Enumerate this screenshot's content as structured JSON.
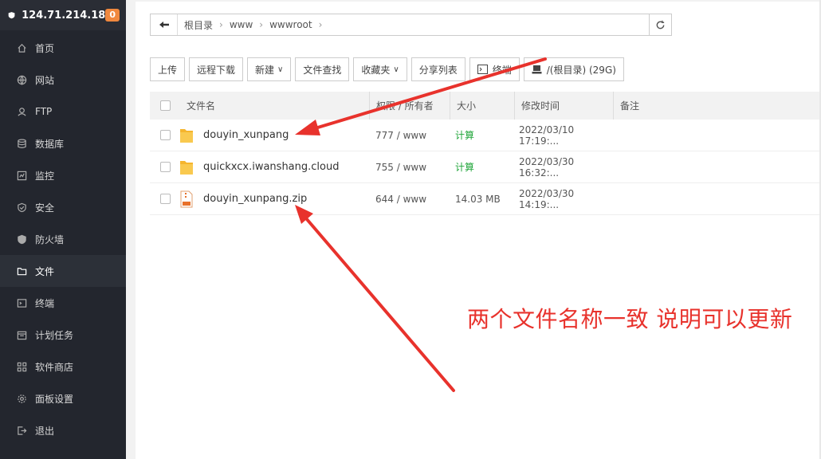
{
  "sidebar": {
    "ip": "124.71.214.18",
    "badge": "0",
    "items": [
      {
        "label": "首页",
        "icon": "home-icon"
      },
      {
        "label": "网站",
        "icon": "globe-icon"
      },
      {
        "label": "FTP",
        "icon": "ftp-icon"
      },
      {
        "label": "数据库",
        "icon": "database-icon"
      },
      {
        "label": "监控",
        "icon": "monitor-icon"
      },
      {
        "label": "安全",
        "icon": "shield-icon"
      },
      {
        "label": "防火墙",
        "icon": "firewall-icon"
      },
      {
        "label": "文件",
        "icon": "folder-icon"
      },
      {
        "label": "终端",
        "icon": "terminal-icon"
      },
      {
        "label": "计划任务",
        "icon": "calendar-icon"
      },
      {
        "label": "软件商店",
        "icon": "grid-icon"
      },
      {
        "label": "面板设置",
        "icon": "gear-icon"
      },
      {
        "label": "退出",
        "icon": "logout-icon"
      }
    ]
  },
  "path": {
    "crumbs": [
      "根目录",
      "www",
      "wwwroot"
    ]
  },
  "toolbar": {
    "upload": "上传",
    "remote_download": "远程下载",
    "new": "新建",
    "find": "文件查找",
    "favorites": "收藏夹",
    "share_list": "分享列表",
    "terminal": "终端",
    "disk": "/(根目录) (29G)"
  },
  "table": {
    "headers": {
      "name": "文件名",
      "perm": "权限 / 所有者",
      "size": "大小",
      "mtime": "修改时间",
      "note": "备注"
    },
    "rows": [
      {
        "name": "douyin_xunpang",
        "type": "folder",
        "perm": "777 / www",
        "size": "计算",
        "mtime": "2022/03/10 17:19:..."
      },
      {
        "name": "quickxcx.iwanshang.cloud",
        "type": "folder",
        "perm": "755 / www",
        "size": "计算",
        "mtime": "2022/03/30 16:32:..."
      },
      {
        "name": "douyin_xunpang.zip",
        "type": "zip",
        "perm": "644 / www",
        "size": "14.03 MB",
        "mtime": "2022/03/30 14:19:..."
      }
    ]
  },
  "annotation": {
    "text": "两个文件名称一致  说明可以更新",
    "color": "#e8322c"
  },
  "colors": {
    "sidebar_bg": "#23262e",
    "accent_green": "#20a53a",
    "badge": "#f0883e"
  }
}
